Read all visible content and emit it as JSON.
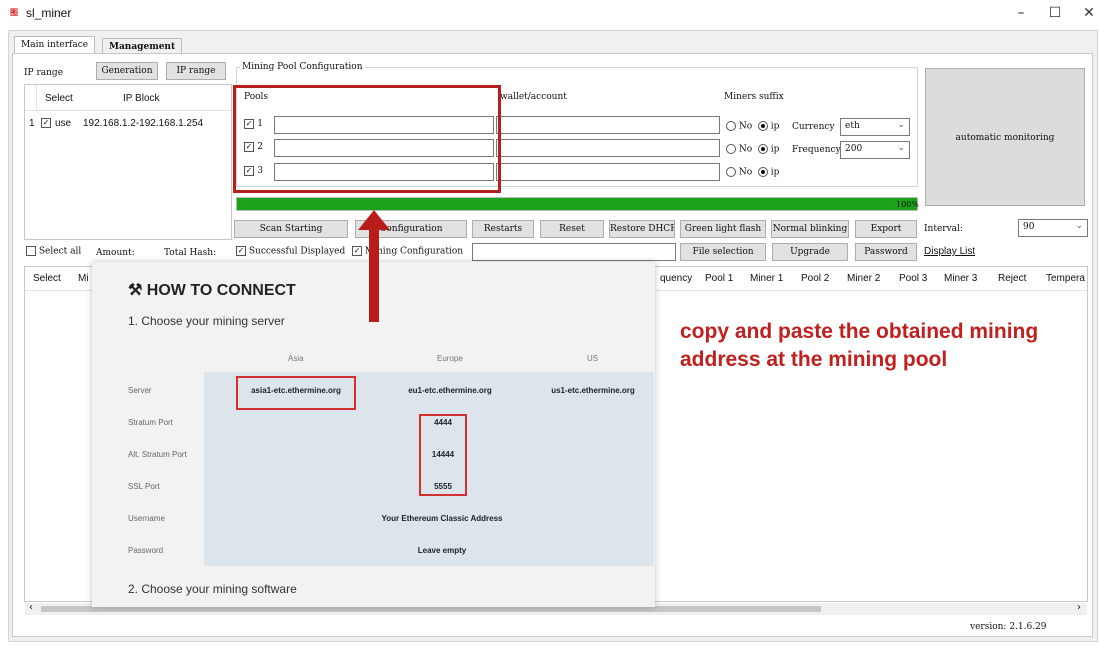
{
  "window": {
    "app_icon": "图",
    "title": "sl_miner",
    "minimize": "–",
    "maximize": "☐",
    "close": "✕"
  },
  "tabs": [
    "Main interface",
    "Management"
  ],
  "ip_range": {
    "label": "IP range",
    "generation_button": "Generation",
    "ip_range_button": "IP range",
    "headers": [
      "Select",
      "IP Block"
    ],
    "rows": [
      {
        "num": "1",
        "select": "use",
        "block": "192.168.1.2-192.168.1.254"
      }
    ]
  },
  "mining_pool": {
    "group_title": "Mining Pool Configuration",
    "pools_label": "Pools",
    "wallet_label": "wallet/account",
    "suffix_label": "Miners suffix",
    "pools": [
      "1",
      "2",
      "3"
    ],
    "radio_no": "No",
    "radio_ip": "ip",
    "currency_label": "Currency",
    "currency_value": "eth",
    "frequency_label": "Frequency",
    "frequency_value": "200"
  },
  "monitor_button": "automatic monitoring",
  "progress": {
    "value": 1.0,
    "label": "100%",
    "color": "#1aa31a"
  },
  "toolbar": {
    "scan": "Scan Starting",
    "configuration": "Configuration",
    "restarts": "Restarts",
    "reset": "Reset",
    "restore_dhcp": "Restore DHCP",
    "green_flash": "Green light flash",
    "normal_blinking": "Normal blinking",
    "export": "Export",
    "interval_label": "Interval:",
    "interval_value": "90"
  },
  "toolbar2": {
    "select_all": "Select all",
    "amount": "Amount:",
    "total_hash": "Total Hash:",
    "successful_displayed": "Successful Displayed",
    "mining_configuration": "Mining Configuration",
    "file_selection": "File selection",
    "upgrade": "Upgrade",
    "password": "Password",
    "display_list": "Display List"
  },
  "grid_headers": {
    "left": [
      "Select",
      "Mi"
    ],
    "right": [
      "quency",
      "Pool 1",
      "Miner 1",
      "Pool 2",
      "Miner 2",
      "Pool 3",
      "Miner 3",
      "Reject",
      "Tempera"
    ]
  },
  "version": "version: 2.1.6.29",
  "overlay": {
    "icon": "⚒",
    "title": "HOW TO CONNECT",
    "step1": "1. Choose your mining server",
    "regions": [
      "Asia",
      "Europe",
      "US"
    ],
    "rows": [
      {
        "label": "Server",
        "values": [
          "asia1-etc.ethermine.org",
          "eu1-etc.ethermine.org",
          "us1-etc.ethermine.org"
        ]
      },
      {
        "label": "Stratum Port",
        "value": "4444"
      },
      {
        "label": "Alt. Stratum Port",
        "value": "14444"
      },
      {
        "label": "SSL Port",
        "value": "5555"
      },
      {
        "label": "Username",
        "value": "Your Ethereum Classic Address"
      },
      {
        "label": "Password",
        "value": "Leave empty"
      }
    ],
    "step2": "2. Choose your mining software"
  },
  "annotation_text": "copy and paste the obtained mining address at the mining pool",
  "accent_red": "#c0201e"
}
